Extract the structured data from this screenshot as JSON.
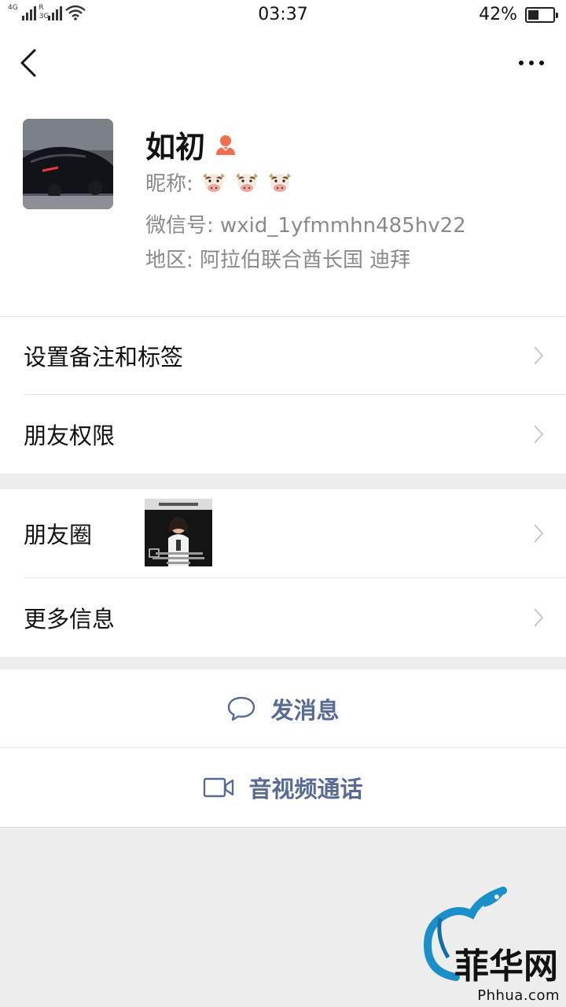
{
  "status_bar": {
    "network_1": "4G",
    "network_2": "3G",
    "roaming": "R",
    "time": "03:37",
    "battery_percent": "42%",
    "battery_level": 0.42
  },
  "nav": {
    "back_icon": "chevron-left-icon",
    "more_icon": "more-dots-icon"
  },
  "profile": {
    "name": "如初",
    "gender_icon": "female-user-icon",
    "nickname_label": "昵称:",
    "nickname_emojis": [
      "cow-face-emoji",
      "cow-face-emoji",
      "cow-face-emoji"
    ],
    "wechat_id": "微信号: wxid_1yfmmhn485hv22",
    "region": "地区: 阿拉伯联合酋长国  迪拜"
  },
  "group1": {
    "items": [
      {
        "label": "设置备注和标签"
      },
      {
        "label": "朋友权限"
      }
    ]
  },
  "group2": {
    "items": [
      {
        "label": "朋友圈"
      },
      {
        "label": "更多信息"
      }
    ]
  },
  "actions": {
    "message": "发消息",
    "video_call": "音视频通话"
  },
  "colors": {
    "link_blue": "#576b95",
    "gender_orange": "#f06e4e",
    "bg_gray": "#ededed"
  },
  "watermark": {
    "site": "Phhua.com",
    "brand": "菲华网"
  }
}
